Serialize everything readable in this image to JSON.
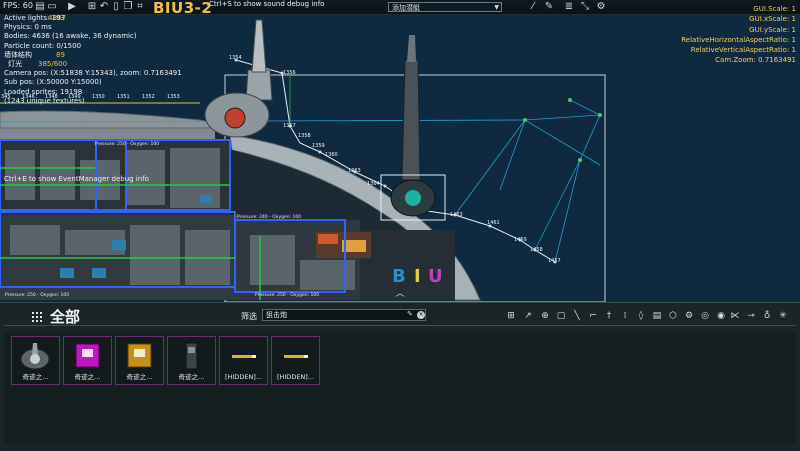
{
  "toolbar": {
    "fps": "FPS: 60",
    "sub_name": "BIU3-2",
    "sound_hint": "Ctrl+S to show sound debug info",
    "sub_select": "添加潜艇",
    "icons": [
      "save-icon",
      "folder-icon",
      "play-icon",
      "grid-icon",
      "undo-icon",
      "file-icon",
      "copy-icon",
      "crop-icon",
      "wiring-icon",
      "pencil-icon",
      "list-icon",
      "arrows-icon",
      "gear-icon"
    ]
  },
  "debug": {
    "active_lights": "Active lights: 193",
    "unknown_value": "4807",
    "physics": "Physics: 0 ms",
    "bodies": "Bodies: 4636 (16 awake, 36 dynamic)",
    "particles": "Particle count: 0/1500",
    "structure_label": "墙体结构",
    "structure_value": "89",
    "light_label": "灯光",
    "light_value": "385/600",
    "camera_pos": "Camera pos: (X:51838 Y:15343), zoom: 0.7163491",
    "sub_pos": "Sub pos: (X:50000 Y:15000)",
    "loaded_sprites": "Loaded sprites: 19198",
    "unique_textures": "(1243 unique textures)",
    "eventmgr_hint": "Ctrl+E to show EventManager debug info"
  },
  "rdebug": [
    "GUI.Scale: 1",
    "GUI.xScale: 1",
    "GUI.yScale: 1",
    "RelativeHorizontalAspectRatio: 1",
    "RelativeVerticalAspectRatio: 1",
    "Cam.Zoom: 0.7163491"
  ],
  "scene": {
    "node_labels": [
      "1354",
      "1356",
      "1357",
      "1358",
      "1359",
      "1360",
      "1363",
      "1364",
      "1463",
      "1461",
      "1459",
      "1458",
      "1457",
      "345",
      "1346",
      "1348",
      "1349",
      "1350",
      "1351",
      "1352",
      "1353"
    ],
    "room_labels": [
      "Pressure: 250 - Oxygen: 100",
      "Pressure: 240 - Oxygen: 100",
      "Pressure: 250 - Oxygen: 100",
      "Pressure: 250 - Oxygen: 100"
    ],
    "hull_letters": [
      "B",
      "I",
      "U"
    ]
  },
  "panel": {
    "category": "全部",
    "filter_label": "筛选",
    "filter_value": "狙击炮",
    "category_icons": [
      "hammer-icon",
      "medkit-icon",
      "computer-icon",
      "tool-icon",
      "gun-icon",
      "dagger-icon",
      "ammo-icon",
      "shell-icon",
      "book-icon",
      "chip-icon",
      "gear-icon",
      "circle-icon",
      "orb-icon",
      "atom-icon",
      "fish-icon",
      "wrench-icon",
      "bulb-icon",
      "star-icon"
    ],
    "items": [
      {
        "label": "奇迹之...",
        "icon": "turret-icon"
      },
      {
        "label": "奇迹之...",
        "icon": "purple-box-icon"
      },
      {
        "label": "奇迹之...",
        "icon": "ammo-box-icon"
      },
      {
        "label": "奇迹之...",
        "icon": "loader-icon"
      },
      {
        "label": "[HIDDEN]...",
        "icon": "bullet-icon"
      },
      {
        "label": "[HIDDEN]...",
        "icon": "bullet-icon"
      }
    ]
  }
}
